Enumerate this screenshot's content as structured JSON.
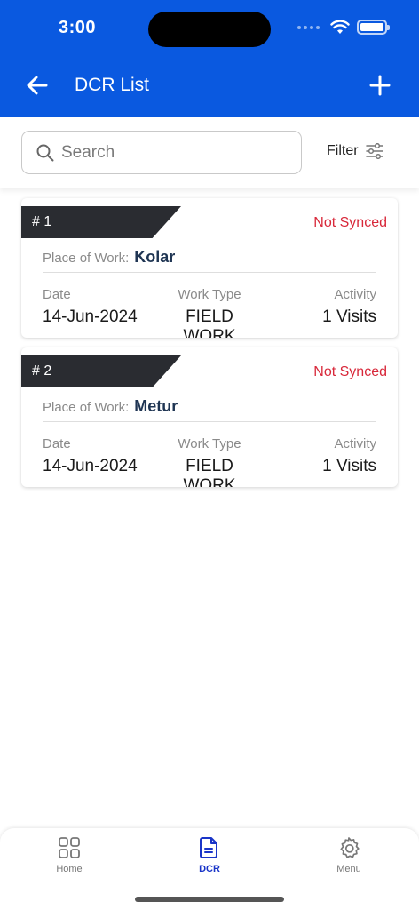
{
  "status_bar": {
    "time": "3:00"
  },
  "header": {
    "title": "DCR List"
  },
  "search": {
    "placeholder": "Search"
  },
  "filter": {
    "label": "Filter"
  },
  "labels": {
    "place_of_work": "Place of Work:",
    "date": "Date",
    "work_type": "Work Type",
    "activity": "Activity"
  },
  "cards": [
    {
      "number": "# 1",
      "status": "Not Synced",
      "place": "Kolar",
      "date": "14-Jun-2024",
      "work_type": "FIELD WORK",
      "activity": "1 Visits"
    },
    {
      "number": "# 2",
      "status": "Not Synced",
      "place": "Metur",
      "date": "14-Jun-2024",
      "work_type": "FIELD WORK",
      "activity": "1 Visits"
    }
  ],
  "bottom_nav": {
    "items": [
      {
        "label": "Home",
        "icon": "grid-icon"
      },
      {
        "label": "DCR",
        "icon": "document-icon",
        "active": true
      },
      {
        "label": "Menu",
        "icon": "gear-icon"
      }
    ]
  },
  "colors": {
    "primary": "#0a59e0",
    "status_not_synced": "#d8283a",
    "card_badge": "#2a2c31",
    "nav_active": "#1a35c8"
  }
}
